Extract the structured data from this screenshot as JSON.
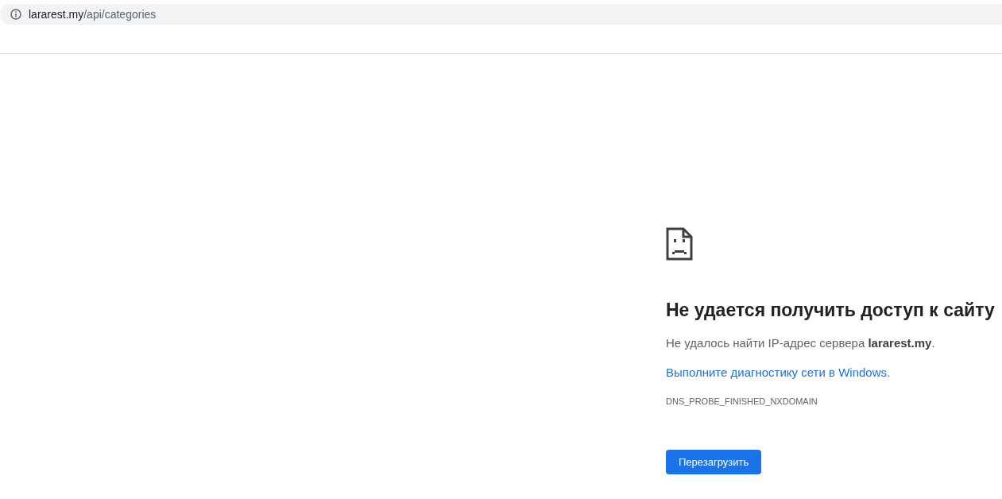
{
  "address_bar": {
    "host": "lararest.my",
    "path": "/api/categories"
  },
  "error": {
    "heading": "Не удается получить доступ к сайту",
    "message": "Не удалось найти IP-адрес сервера **lararest.my**.",
    "link": "Выполните диагностику сети в Windows.",
    "code": "DNS_PROBE_FINISHED_NXDOMAIN",
    "button": "Перезагрузить"
  }
}
